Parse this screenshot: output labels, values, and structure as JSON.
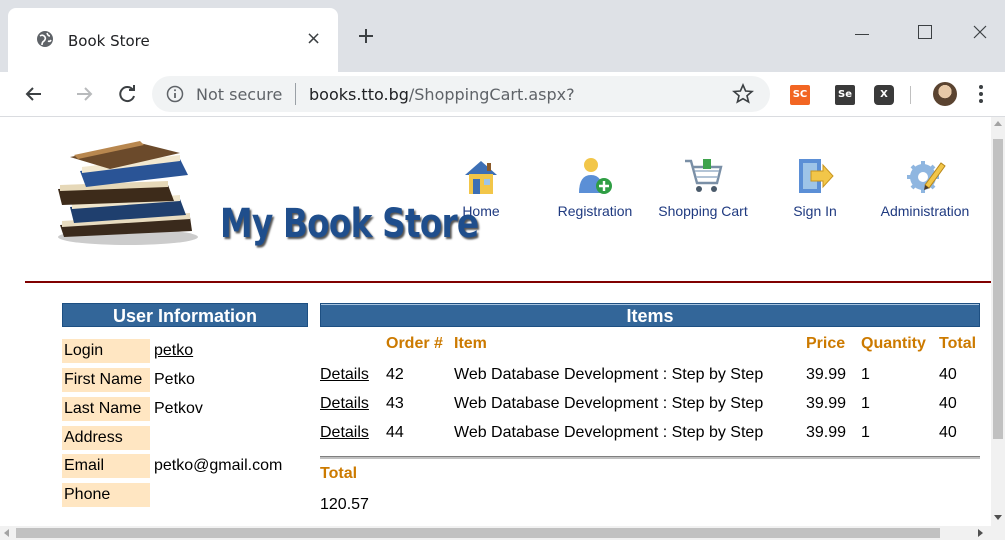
{
  "browser": {
    "tab_title": "Book Store",
    "tab_close": "×",
    "security_label": "Not secure",
    "url_domain": "books.tto.bg",
    "url_path": "/ShoppingCart.aspx?",
    "extensions": [
      "SC",
      "Se",
      "X"
    ]
  },
  "site": {
    "logo_text": "My Book Store",
    "nav": [
      {
        "label": "Home",
        "icon": "house-icon"
      },
      {
        "label": "Registration",
        "icon": "add-user-icon"
      },
      {
        "label": "Shopping Cart",
        "icon": "cart-icon"
      },
      {
        "label": "Sign In",
        "icon": "sign-in-icon"
      },
      {
        "label": "Administration",
        "icon": "gear-pencil-icon"
      }
    ]
  },
  "user_info": {
    "title": "User Information",
    "rows": [
      {
        "label": "Login",
        "value": "petko"
      },
      {
        "label": "First Name",
        "value": "Petko"
      },
      {
        "label": "Last Name",
        "value": "Petkov"
      },
      {
        "label": "Address",
        "value": ""
      },
      {
        "label": "Email",
        "value": "petko@gmail.com"
      },
      {
        "label": "Phone",
        "value": ""
      }
    ]
  },
  "items": {
    "title": "Items",
    "columns": {
      "order": "Order #",
      "item": "Item",
      "price": "Price",
      "quantity": "Quantity",
      "total": "Total"
    },
    "rows": [
      {
        "details": "Details",
        "order": "42",
        "item": "Web Database Development : Step by Step",
        "price": "39.99",
        "quantity": "1",
        "total": "40"
      },
      {
        "details": "Details",
        "order": "43",
        "item": "Web Database Development : Step by Step",
        "price": "39.99",
        "quantity": "1",
        "total": "40"
      },
      {
        "details": "Details",
        "order": "44",
        "item": "Web Database Development : Step by Step",
        "price": "39.99",
        "quantity": "1",
        "total": "40"
      }
    ],
    "total_label": "Total",
    "total_value": "120.57"
  },
  "colors": {
    "header_bg": "#336699",
    "label_bg": "#ffe6c2",
    "accent_orange": "#cc7a00",
    "divider": "#800000"
  }
}
